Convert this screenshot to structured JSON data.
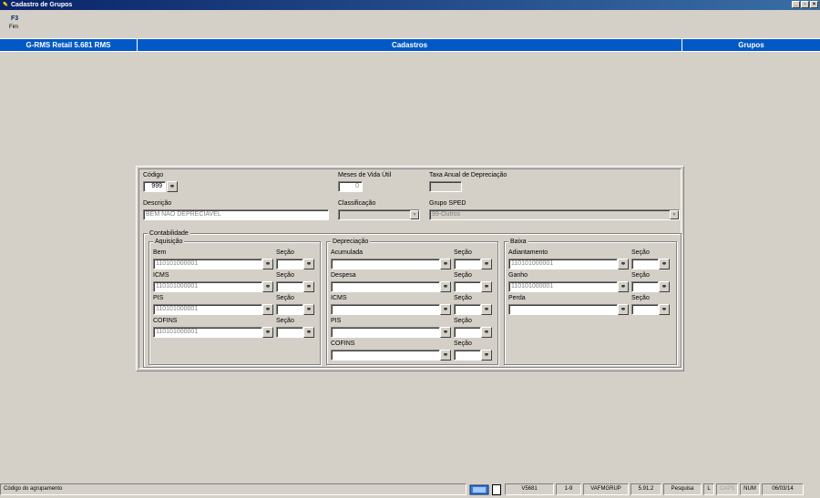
{
  "window": {
    "title": "Cadastro de Grupos"
  },
  "shortcut": {
    "key": "F3",
    "label": "Fim"
  },
  "header": {
    "left": "G-RMS Retail 5.681 RMS",
    "center": "Cadastros",
    "right": "Grupos"
  },
  "form": {
    "codigo_label": "Código",
    "codigo_value": "999",
    "meses_label": "Meses de Vida Útil",
    "meses_value": "0",
    "taxa_label": "Taxa Anual de Depreciação",
    "taxa_value": "",
    "descricao_label": "Descrição",
    "descricao_value": "BEM NAO DEPRECIAVEL",
    "classificacao_label": "Classificação",
    "classificacao_value": "",
    "grupo_sped_label": "Grupo SPED",
    "grupo_sped_value": "99-Outros"
  },
  "contabilidade": {
    "title": "Contabilidade",
    "secao_label": "Seção",
    "aquisicao": {
      "title": "Aquisição",
      "fields": [
        {
          "label": "Bem",
          "value": "110101000001"
        },
        {
          "label": "ICMS",
          "value": "110101000001"
        },
        {
          "label": "PIS",
          "value": "110101000001"
        },
        {
          "label": "COFINS",
          "value": "110101000001"
        }
      ]
    },
    "depreciacao": {
      "title": "Depreciação",
      "fields": [
        {
          "label": "Acumulada",
          "value": ""
        },
        {
          "label": "Despesa",
          "value": ""
        },
        {
          "label": "ICMS",
          "value": ""
        },
        {
          "label": "PIS",
          "value": ""
        },
        {
          "label": "COFINS",
          "value": ""
        }
      ]
    },
    "baixa": {
      "title": "Baixa",
      "fields": [
        {
          "label": "Adiantamento",
          "value": "110101000001"
        },
        {
          "label": "Ganho",
          "value": "110101000001"
        },
        {
          "label": "Perda",
          "value": ""
        }
      ]
    }
  },
  "statusbar": {
    "message": "Código do agrupamento",
    "version": "V5681",
    "page": "1-9",
    "program": "VAFMGRUP",
    "build": "5.91.2",
    "mode": "Pesquisa",
    "l": "L",
    "caps": "CAPS",
    "num": "NUM",
    "date": "06/03/14"
  },
  "icons": {
    "lookup": "binoculars-icon",
    "app": "app-icon"
  }
}
